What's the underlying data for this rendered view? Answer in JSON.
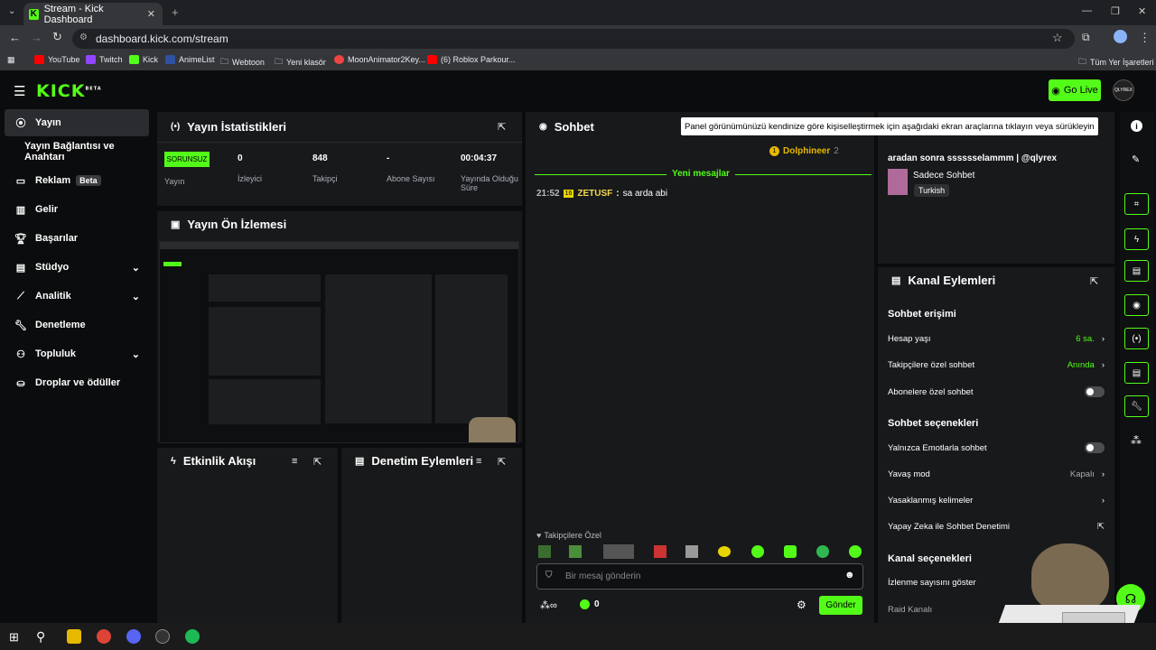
{
  "browser": {
    "tab_title": "Stream - Kick Dashboard",
    "url": "dashboard.kick.com/stream",
    "bookmarks": [
      "YouTube",
      "Twitch",
      "Kick",
      "AnimeList",
      "Webtoon",
      "Yeni klasör",
      "MoonAnimator2Key...",
      "(6) Roblox Parkour..."
    ],
    "all_bookmarks": "Tüm Yer İşaretleri"
  },
  "header": {
    "logo": "KICK",
    "logo_sup": "BETA",
    "go_live": "Go Live",
    "avatar": "QLYREX"
  },
  "sidebar": {
    "items": [
      {
        "label": "Yayın",
        "icon": "broadcast-icon"
      },
      {
        "label": "Yayın Bağlantısı ve Anahtarı"
      },
      {
        "label": "Reklam",
        "badge": "Beta",
        "icon": "ad-icon"
      },
      {
        "label": "Gelir",
        "icon": "chart-icon"
      },
      {
        "label": "Başarılar",
        "icon": "trophy-icon"
      },
      {
        "label": "Stüdyo",
        "icon": "studio-icon"
      },
      {
        "label": "Analitik",
        "icon": "analytics-icon"
      },
      {
        "label": "Denetleme",
        "icon": "wrench-icon"
      },
      {
        "label": "Topluluk",
        "icon": "community-icon"
      },
      {
        "label": "Droplar ve ödüller",
        "icon": "gift-icon"
      }
    ]
  },
  "stats": {
    "title": "Yayın İstatistikleri",
    "status": "SORUNSUZ",
    "status_label": "Yayın",
    "items": [
      {
        "value": "0",
        "label": "İzleyici"
      },
      {
        "value": "848",
        "label": "Takipçi"
      },
      {
        "value": "-",
        "label": "Abone Sayısı"
      },
      {
        "value": "00:04:37",
        "label": "Yayında Olduğu Süre"
      }
    ]
  },
  "preview": {
    "title": "Yayın Ön İzlemesi"
  },
  "activity": {
    "title": "Etkinlik Akışı"
  },
  "moderation": {
    "title": "Denetim Eylemleri"
  },
  "chat": {
    "title": "Sohbet",
    "top_user": "Dolphineer",
    "top_count": "2",
    "new_messages": "Yeni mesajlar",
    "messages": [
      {
        "time": "21:52",
        "badge": "16",
        "user": "ZETUSF",
        "text": "sa arda abi"
      }
    ],
    "followers_only": "Takipçilere Özel",
    "placeholder": "Bir mesaj gönderin",
    "points": "0",
    "send": "Gönder"
  },
  "tooltip": "Panel görünümünüzü kendinize göre kişiselleştirmek için aşağıdaki ekran araçlarına tıklayın veya sürükleyin",
  "stream_info": {
    "title": "aradan sonra sssssselammm | @qlyrex",
    "category": "Sadece Sohbet",
    "language": "Turkish"
  },
  "channel_actions": {
    "title": "Kanal Eylemleri",
    "chat_access": "Sohbet erişimi",
    "account_age": {
      "label": "Hesap yaşı",
      "value": "6 sa."
    },
    "followers_chat": {
      "label": "Takipçilere özel sohbet",
      "value": "Anında"
    },
    "subs_chat": "Abonelere özel sohbet",
    "chat_options": "Sohbet seçenekleri",
    "emote_only": "Yalnızca Emotlarla sohbet",
    "slow_mode": {
      "label": "Yavaş mod",
      "value": "Kapalı"
    },
    "banned_words": "Yasaklanmış kelimeler",
    "ai_mod": "Yapay Zeka ile Sohbet Denetimi",
    "channel_options": "Kanal seçenekleri",
    "show_views": "İzlenme sayısını göster",
    "raid": "Raid Kanalı"
  },
  "colors": {
    "accent": "#53fc18",
    "panel": "#18191b",
    "bg": "#0b0c0d"
  }
}
